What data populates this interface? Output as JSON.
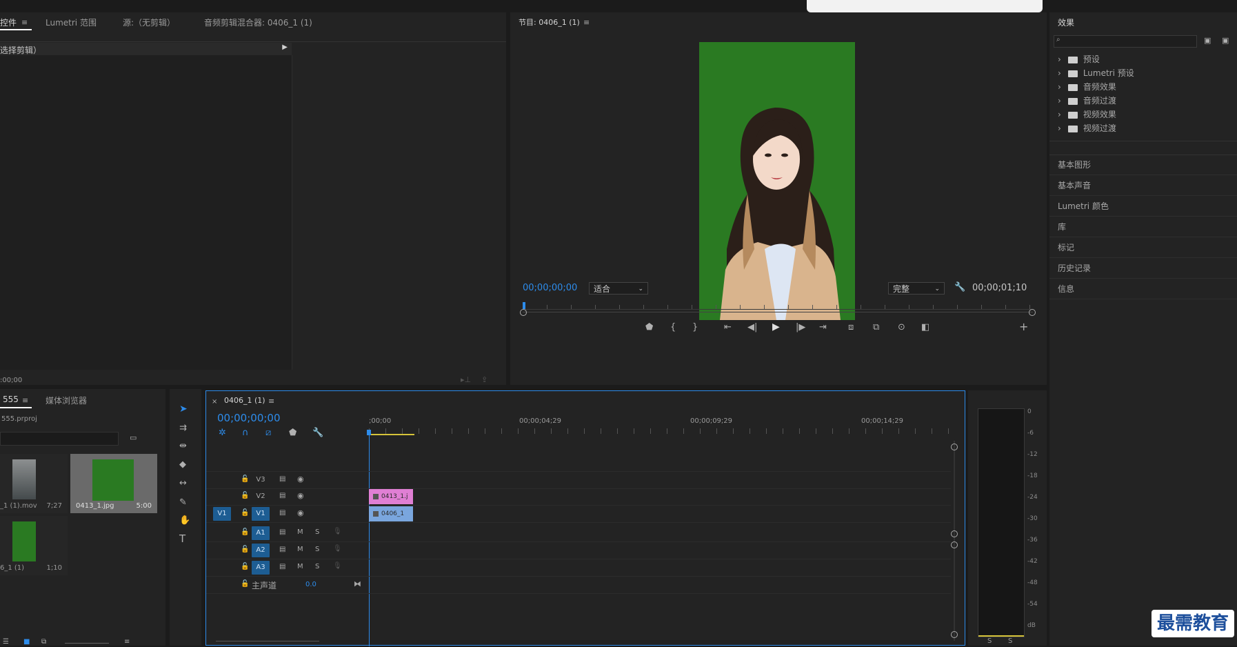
{
  "top_left_panel": {
    "tabs": [
      "控件",
      "Lumetri 范围",
      "源:（无剪辑）",
      "音频剪辑混合器: 0406_1 (1)"
    ],
    "clip_label": "选择剪辑）",
    "timecode": ":00;00"
  },
  "program_monitor": {
    "title": "节目: 0406_1 (1)",
    "timecode_left": "00;00;00;00",
    "fit_label": "适合",
    "quality_label": "完整",
    "timecode_right": "00;00;01;10"
  },
  "effects_panel": {
    "title": "效果",
    "search_placeholder": "",
    "items": [
      "预设",
      "Lumetri 预设",
      "音频效果",
      "音频过渡",
      "视频效果",
      "视频过渡"
    ],
    "side_panels": [
      "基本图形",
      "基本声音",
      "Lumetri 颜色",
      "库",
      "标记",
      "历史记录",
      "信息"
    ]
  },
  "project_panel": {
    "tabs": [
      "555",
      "媒体浏览器"
    ],
    "project_file": "555.prproj",
    "items": [
      {
        "name": "_1 (1).mov",
        "duration": "7;27"
      },
      {
        "name": "0413_1.jpg",
        "duration": "5:00"
      },
      {
        "name": "6_1 (1)",
        "duration": "1;10"
      }
    ]
  },
  "timeline": {
    "title": "0406_1 (1)",
    "timecode": "00;00;00;00",
    "ruler": [
      ";00;00",
      "00;00;04;29",
      "00;00;09;29",
      "00;00;14;29"
    ],
    "video_tracks": [
      "V3",
      "V2",
      "V1"
    ],
    "source_patch": "V1",
    "audio_tracks": [
      "A1",
      "A2",
      "A3"
    ],
    "mute_label": "M",
    "solo_label": "S",
    "master": {
      "label": "主声道",
      "value": "0.0"
    },
    "clips": {
      "v2": "0413_1.j",
      "v1": "0406_1"
    }
  },
  "audio_meter": {
    "labels": [
      "0",
      "-6",
      "-12",
      "-18",
      "-24",
      "-30",
      "-36",
      "-42",
      "-48",
      "-54",
      "dB"
    ],
    "solo": [
      "S",
      "S"
    ]
  },
  "watermark": "最需教育",
  "colors": {
    "accent": "#2d8ceb",
    "green_screen": "#2a7a22",
    "clip_pink": "#e07fd4",
    "clip_blue": "#7aa6de",
    "meter_yellow": "#d6c43a"
  }
}
